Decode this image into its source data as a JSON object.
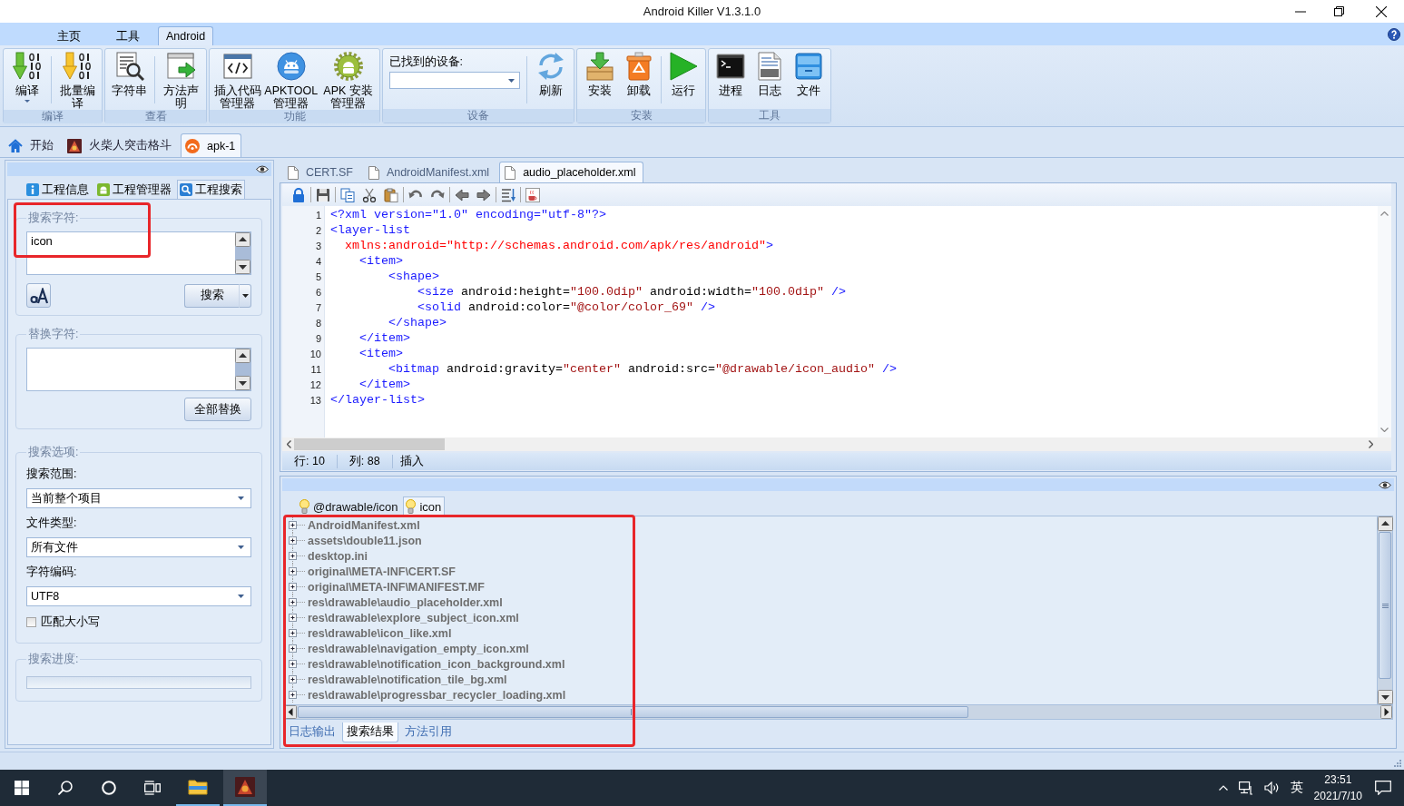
{
  "window": {
    "title": "Android Killer V1.3.1.0"
  },
  "ribbon": {
    "tabs": [
      {
        "label": "主页",
        "selected": false
      },
      {
        "label": "工具",
        "selected": false
      },
      {
        "label": "Android",
        "selected": true
      }
    ],
    "groups": [
      {
        "label": "编译",
        "kind": "buttons",
        "sections": [
          [
            {
              "label": "编译",
              "kind": "compile",
              "dropdown": true
            }
          ],
          [
            {
              "label": "批量编译",
              "kind": "batch-compile",
              "dropdown": false
            }
          ]
        ]
      },
      {
        "label": "查看",
        "kind": "buttons",
        "sections": [
          [
            {
              "label": "字符串",
              "kind": "strings",
              "dropdown": false
            }
          ],
          [
            {
              "label": "方法声明",
              "kind": "method",
              "dropdown": false
            }
          ]
        ]
      },
      {
        "label": "功能",
        "kind": "buttons",
        "sections": [
          [
            {
              "label": "插入代码管理器",
              "kind": "insert-code",
              "dropdown": false
            },
            {
              "label": "APKTOOL管理器",
              "kind": "apktool",
              "dropdown": false
            },
            {
              "label": "APK 安装管理器",
              "kind": "apk-installer",
              "dropdown": false
            }
          ]
        ]
      },
      {
        "label": "设备",
        "kind": "device",
        "field_label": "已找到的设备:",
        "sections": [
          [
            {
              "label": "刷新",
              "kind": "refresh",
              "dropdown": false
            }
          ]
        ]
      },
      {
        "label": "安装",
        "kind": "buttons",
        "sections": [
          [
            {
              "label": "安装",
              "kind": "install",
              "dropdown": false
            },
            {
              "label": "卸载",
              "kind": "uninstall",
              "dropdown": false
            }
          ],
          [
            {
              "label": "运行",
              "kind": "run",
              "dropdown": false
            }
          ]
        ]
      },
      {
        "label": "工具",
        "kind": "buttons",
        "sections": [
          [
            {
              "label": "进程",
              "kind": "process",
              "dropdown": false
            },
            {
              "label": "日志",
              "kind": "log",
              "dropdown": false
            },
            {
              "label": "文件",
              "kind": "file",
              "dropdown": false
            }
          ]
        ]
      }
    ]
  },
  "documents": [
    {
      "label": "开始",
      "kind": "home",
      "selected": false
    },
    {
      "label": "火柴人突击格斗",
      "kind": "game",
      "selected": false
    },
    {
      "label": "apk-1",
      "kind": "apk",
      "selected": true
    }
  ],
  "project_panel": {
    "tabs": [
      {
        "label": "工程信息",
        "kind": "info",
        "selected": false
      },
      {
        "label": "工程管理器",
        "kind": "android",
        "selected": false
      },
      {
        "label": "工程搜索",
        "kind": "search",
        "selected": true
      }
    ],
    "search": {
      "legend": "搜索字符:",
      "value": "icon",
      "button": "搜索"
    },
    "replace": {
      "legend": "替换字符:",
      "button": "全部替换"
    },
    "options": {
      "legend": "搜索选项:",
      "fields": [
        {
          "label": "搜索范围:",
          "value": "当前整个项目"
        },
        {
          "label": "文件类型:",
          "value": "所有文件"
        },
        {
          "label": "字符编码:",
          "value": "UTF8"
        }
      ],
      "match_case": {
        "label": "匹配大小写",
        "checked": false
      }
    },
    "progress": {
      "legend": "搜索进度:"
    }
  },
  "editor": {
    "tabs": [
      {
        "label": "CERT.SF",
        "selected": false
      },
      {
        "label": "AndroidManifest.xml",
        "selected": false
      },
      {
        "label": "audio_placeholder.xml",
        "selected": true
      }
    ],
    "lines": [
      {
        "number": "1",
        "tokens": [
          {
            "kind": "tag",
            "text": "<?xml version=\"1.0\" encoding=\"utf-8\"?>"
          }
        ]
      },
      {
        "number": "2",
        "tokens": [
          {
            "kind": "tag",
            "text": "<layer-list"
          }
        ]
      },
      {
        "number": "3",
        "tokens": [
          {
            "kind": "ns",
            "text": "  xmlns:android=\"http://schemas.android.com/apk/res/android\""
          },
          {
            "kind": "tag",
            "text": ">"
          }
        ]
      },
      {
        "number": "4",
        "tokens": [
          {
            "kind": "tag",
            "text": "    <item>"
          }
        ]
      },
      {
        "number": "5",
        "tokens": [
          {
            "kind": "tag",
            "text": "        <shape>"
          }
        ]
      },
      {
        "number": "6",
        "tokens": [
          {
            "kind": "tag",
            "text": "            <size"
          },
          {
            "kind": "attr",
            "text": " android:height="
          },
          {
            "kind": "value",
            "text": "\"100.0dip\""
          },
          {
            "kind": "attr",
            "text": " android:width="
          },
          {
            "kind": "value",
            "text": "\"100.0dip\""
          },
          {
            "kind": "tag",
            "text": " />"
          }
        ]
      },
      {
        "number": "7",
        "tokens": [
          {
            "kind": "tag",
            "text": "            <solid"
          },
          {
            "kind": "attr",
            "text": " android:color="
          },
          {
            "kind": "value",
            "text": "\"@color/color_69\""
          },
          {
            "kind": "tag",
            "text": " />"
          }
        ]
      },
      {
        "number": "8",
        "tokens": [
          {
            "kind": "tag",
            "text": "        </shape>"
          }
        ]
      },
      {
        "number": "9",
        "tokens": [
          {
            "kind": "tag",
            "text": "    </item>"
          }
        ]
      },
      {
        "number": "10",
        "tokens": [
          {
            "kind": "tag",
            "text": "    <item>"
          }
        ]
      },
      {
        "number": "11",
        "tokens": [
          {
            "kind": "tag",
            "text": "        <bitmap"
          },
          {
            "kind": "attr",
            "text": " android:gravity="
          },
          {
            "kind": "value",
            "text": "\"center\""
          },
          {
            "kind": "attr",
            "text": " android:src="
          },
          {
            "kind": "value",
            "text": "\"@drawable/icon_audio\""
          },
          {
            "kind": "tag",
            "text": " />"
          }
        ]
      },
      {
        "number": "12",
        "tokens": [
          {
            "kind": "tag",
            "text": "    </item>"
          }
        ]
      },
      {
        "number": "13",
        "tokens": [
          {
            "kind": "tag",
            "text": "</layer-list>"
          }
        ]
      }
    ],
    "status": {
      "line": "行: 10",
      "column": "列: 88",
      "mode": "插入"
    }
  },
  "results": {
    "tabs": [
      {
        "label": "@drawable/icon",
        "selected": false
      },
      {
        "label": "icon",
        "selected": true
      }
    ],
    "items": [
      {
        "path": "AndroidManifest.xml",
        "expanded": false
      },
      {
        "path": "assets\\double11.json",
        "expanded": false
      },
      {
        "path": "desktop.ini",
        "expanded": false
      },
      {
        "path": "original\\META-INF\\CERT.SF",
        "expanded": false
      },
      {
        "path": "original\\META-INF\\MANIFEST.MF",
        "expanded": false
      },
      {
        "path": "res\\drawable\\audio_placeholder.xml",
        "expanded": false
      },
      {
        "path": "res\\drawable\\explore_subject_icon.xml",
        "expanded": false
      },
      {
        "path": "res\\drawable\\icon_like.xml",
        "expanded": false
      },
      {
        "path": "res\\drawable\\navigation_empty_icon.xml",
        "expanded": false
      },
      {
        "path": "res\\drawable\\notification_icon_background.xml",
        "expanded": false
      },
      {
        "path": "res\\drawable\\notification_tile_bg.xml",
        "expanded": false
      },
      {
        "path": "res\\drawable\\progressbar_recycler_loading.xml",
        "expanded": false
      }
    ],
    "bottom_tabs": [
      {
        "label": "日志输出",
        "selected": false
      },
      {
        "label": "搜索结果",
        "selected": true
      },
      {
        "label": "方法引用",
        "selected": false
      }
    ]
  },
  "taskbar": {
    "apps": [
      {
        "kind": "explorer",
        "running": true,
        "selected": false
      },
      {
        "kind": "game",
        "running": true,
        "selected": true
      }
    ],
    "ime": "英",
    "time": "23:51",
    "date": "2021/7/10"
  }
}
